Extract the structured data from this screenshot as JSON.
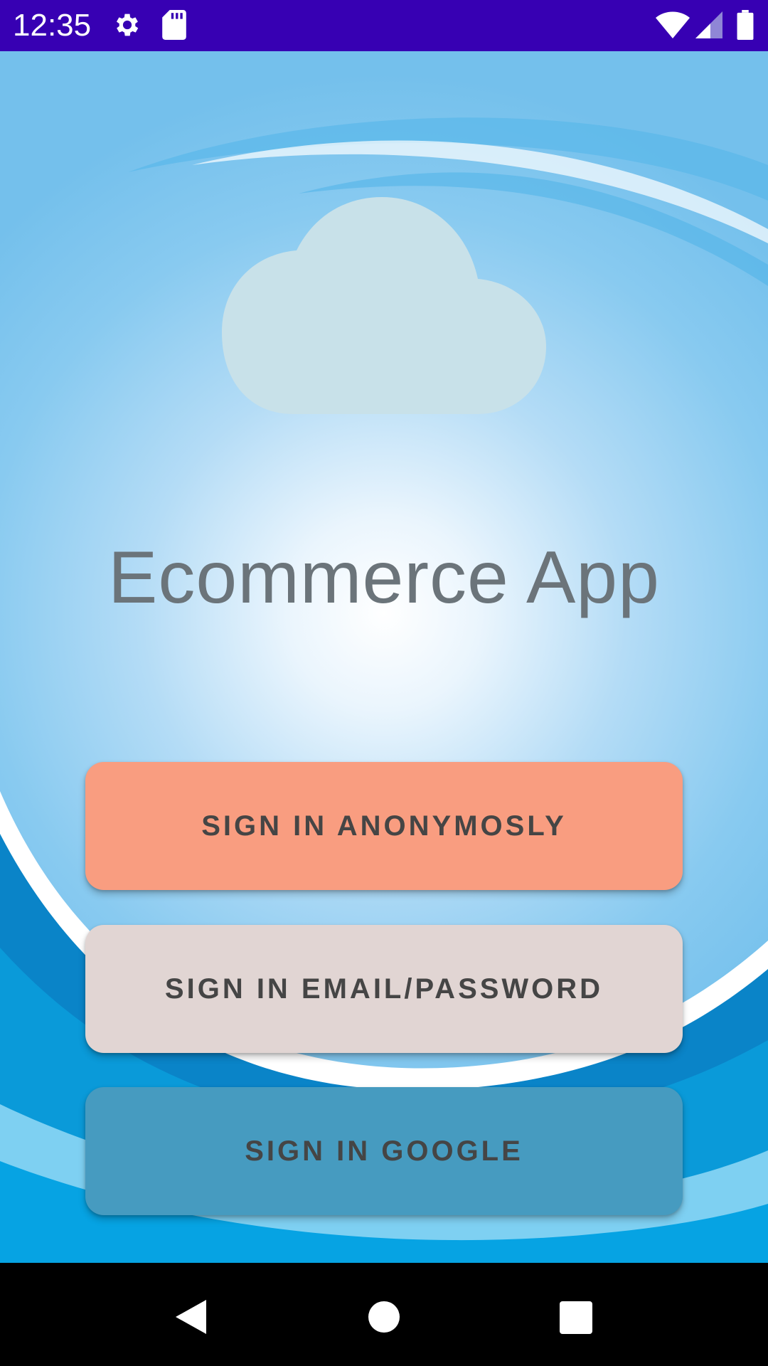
{
  "status_bar": {
    "time": "12:35",
    "left_icons": [
      "gear-icon",
      "sd-card-icon"
    ],
    "right_icons": [
      "wifi-icon",
      "signal-icon",
      "battery-icon"
    ],
    "background_color": "#3700b3"
  },
  "app": {
    "logo_icon": "cloud-icon",
    "title": "Ecommerce App",
    "title_color": "#6b747a"
  },
  "buttons": {
    "anonymous": {
      "label": "SIGN IN ANONYMOSLY",
      "color": "#f99d80"
    },
    "email": {
      "label": "SIGN IN EMAIL/PASSWORD",
      "color": "#e1d5d3"
    },
    "google": {
      "label": "SIGN IN GOOGLE",
      "color": "#469bc0"
    }
  },
  "nav_bar": {
    "icons": [
      "back-icon",
      "home-icon",
      "recents-icon"
    ]
  }
}
